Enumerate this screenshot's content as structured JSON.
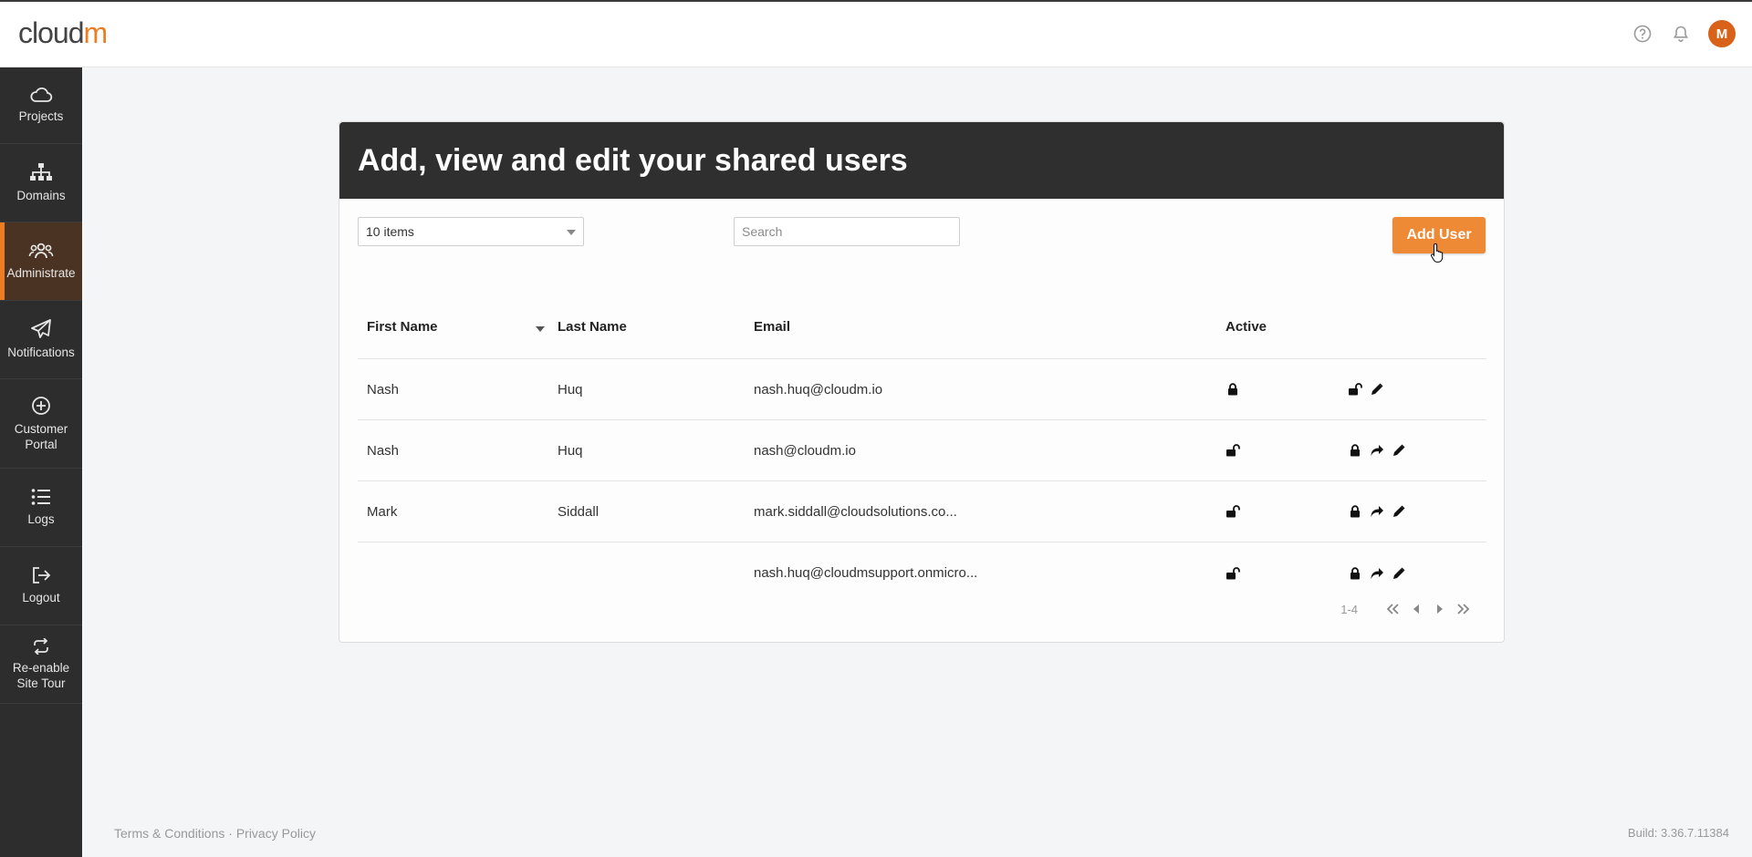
{
  "header": {
    "logo_text": "cloud",
    "logo_accent": "m",
    "help_icon": "help-circle-icon",
    "bell_icon": "bell-icon",
    "avatar_initial": "M"
  },
  "sidebar": {
    "items": [
      {
        "label": "Projects",
        "icon": "cloud-icon"
      },
      {
        "label": "Domains",
        "icon": "sitemap-icon"
      },
      {
        "label": "Administrate",
        "icon": "users-icon",
        "active": true
      },
      {
        "label": "Notifications",
        "icon": "paper-plane-icon"
      },
      {
        "label": "Customer Portal",
        "icon": "plus-circle-icon"
      },
      {
        "label": "Logs",
        "icon": "list-icon"
      },
      {
        "label": "Logout",
        "icon": "logout-icon"
      },
      {
        "label": "Re-enable Site Tour",
        "icon": "repeat-icon"
      }
    ]
  },
  "card": {
    "title": "Add, view and edit your shared users",
    "page_size": "10 items",
    "search_placeholder": "Search",
    "add_button": "Add User"
  },
  "table": {
    "columns": [
      "First Name",
      "Last Name",
      "Email",
      "Active"
    ],
    "rows": [
      {
        "first": "Nash",
        "last": "Huq",
        "email": "nash.huq@cloudm.io",
        "active": "locked"
      },
      {
        "first": "Nash",
        "last": "Huq",
        "email": "nash@cloudm.io",
        "active": "unlocked"
      },
      {
        "first": "Mark",
        "last": "Siddall",
        "email": "mark.siddall@cloudsolutions.co...",
        "active": "unlocked"
      },
      {
        "first": "",
        "last": "",
        "email": "nash.huq@cloudmsupport.onmicro...",
        "active": "unlocked"
      }
    ]
  },
  "pager": {
    "range": "1-4"
  },
  "footer": {
    "links": "Terms & Conditions · Privacy Policy",
    "build": "Build: 3.36.7.11384"
  },
  "colors": {
    "accent": "#ee7d22",
    "sidebar": "#2d2d2d",
    "card_header": "#2f2f2f"
  }
}
